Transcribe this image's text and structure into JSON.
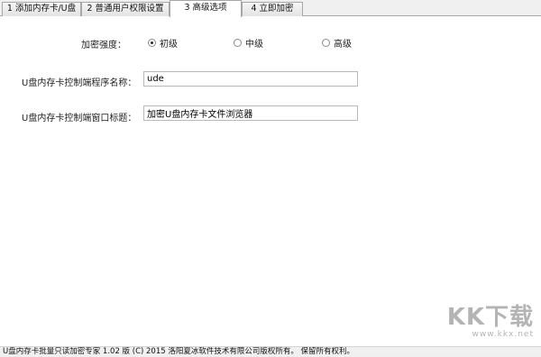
{
  "tabs": [
    {
      "label": "1 添加内存卡/U盘",
      "active": false
    },
    {
      "label": "2 普通用户权限设置",
      "active": false
    },
    {
      "label": "3 高级选项",
      "active": true
    },
    {
      "label": "4 立即加密",
      "active": false
    }
  ],
  "encryption": {
    "label": "加密强度：",
    "options": [
      {
        "label": "初级",
        "selected": true
      },
      {
        "label": "中级",
        "selected": false
      },
      {
        "label": "高级",
        "selected": false
      }
    ]
  },
  "program_name": {
    "label": "U盘内存卡控制端程序名称：",
    "value": "ude"
  },
  "window_title": {
    "label": "U盘内存卡控制端窗口标题：",
    "value": "加密U盘内存卡文件浏览器"
  },
  "status_bar": {
    "text": "U盘内存卡批量只读加密专家 1.02 版  (C) 2015 洛阳夏冰软件技术有限公司版权所有。 保留所有权利。"
  },
  "watermark": {
    "logo": "KK下载",
    "url": "www.kkx.net"
  }
}
